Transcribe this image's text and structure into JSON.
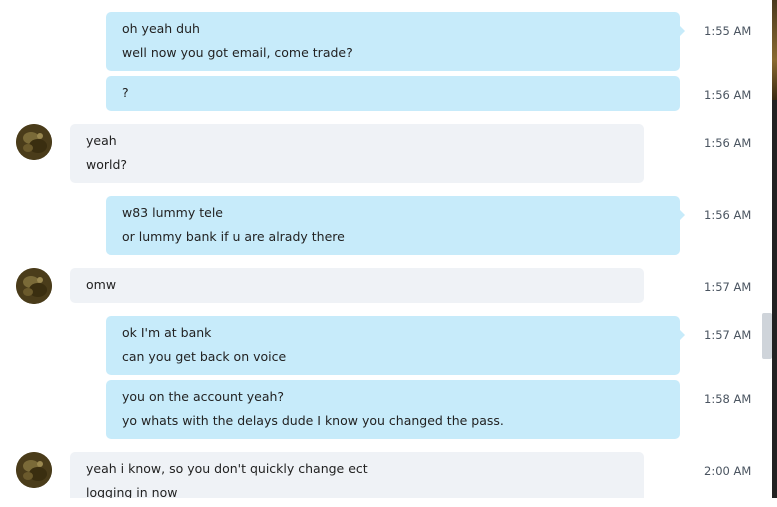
{
  "messages": [
    {
      "direction": "outgoing",
      "lines": [
        "oh yeah duh",
        "well now you got email, come trade?"
      ],
      "time": "1:55 AM"
    },
    {
      "direction": "outgoing",
      "lines": [
        "?"
      ],
      "time": "1:56 AM"
    },
    {
      "direction": "incoming",
      "lines": [
        "yeah",
        "world?"
      ],
      "time": "1:56 AM",
      "avatar": "contact-avatar"
    },
    {
      "direction": "outgoing",
      "lines": [
        "w83 lummy tele",
        "or lummy bank if u are alrady there"
      ],
      "time": "1:56 AM"
    },
    {
      "direction": "incoming",
      "lines": [
        "omw"
      ],
      "time": "1:57 AM",
      "avatar": "contact-avatar"
    },
    {
      "direction": "outgoing",
      "lines": [
        "ok I'm at bank",
        "can you get back on voice"
      ],
      "time": "1:57 AM"
    },
    {
      "direction": "outgoing",
      "lines": [
        "you on the account yeah?",
        "yo whats with the delays dude I know you changed the pass."
      ],
      "time": "1:58 AM"
    },
    {
      "direction": "incoming",
      "lines": [
        "yeah i know, so you don't quickly change ect",
        "logging in now"
      ],
      "time": "2:00 AM",
      "avatar": "contact-avatar"
    }
  ],
  "colors": {
    "outgoing_bubble": "#c7ebfa",
    "incoming_bubble": "#eff2f6",
    "timestamp_text": "#4a5460"
  }
}
